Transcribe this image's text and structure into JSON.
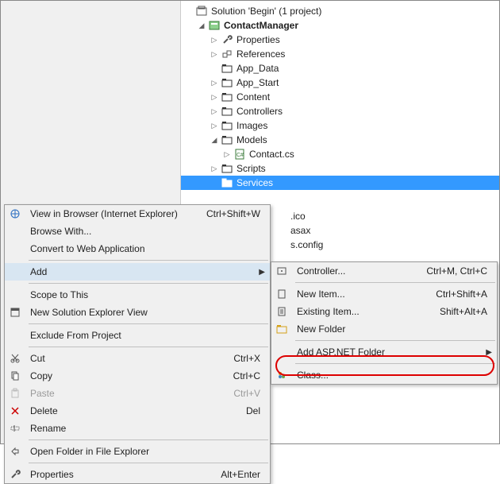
{
  "tree": {
    "solution": "Solution 'Begin' (1 project)",
    "project": "ContactManager",
    "nodes": {
      "properties": "Properties",
      "references": "References",
      "app_data": "App_Data",
      "app_start": "App_Start",
      "content": "Content",
      "controllers": "Controllers",
      "images": "Images",
      "models": "Models",
      "contact_cs": "Contact.cs",
      "scripts": "Scripts",
      "services": "Services",
      "file_ico": ".ico",
      "file_asax": "asax",
      "file_config": "s.config"
    }
  },
  "ctx1": {
    "view_browser": "View in Browser (Internet Explorer)",
    "view_browser_sc": "Ctrl+Shift+W",
    "browse_with": "Browse With...",
    "convert_web": "Convert to Web Application",
    "add": "Add",
    "scope": "Scope to This",
    "new_view": "New Solution Explorer View",
    "exclude": "Exclude From Project",
    "cut": "Cut",
    "cut_sc": "Ctrl+X",
    "copy": "Copy",
    "copy_sc": "Ctrl+C",
    "paste": "Paste",
    "paste_sc": "Ctrl+V",
    "delete": "Delete",
    "delete_sc": "Del",
    "rename": "Rename",
    "open_folder": "Open Folder in File Explorer",
    "properties": "Properties",
    "properties_sc": "Alt+Enter"
  },
  "ctx2": {
    "controller": "Controller...",
    "controller_sc": "Ctrl+M, Ctrl+C",
    "new_item": "New Item...",
    "new_item_sc": "Ctrl+Shift+A",
    "existing": "Existing Item...",
    "existing_sc": "Shift+Alt+A",
    "new_folder": "New Folder",
    "aspnet_folder": "Add ASP.NET Folder",
    "class": "Class..."
  }
}
